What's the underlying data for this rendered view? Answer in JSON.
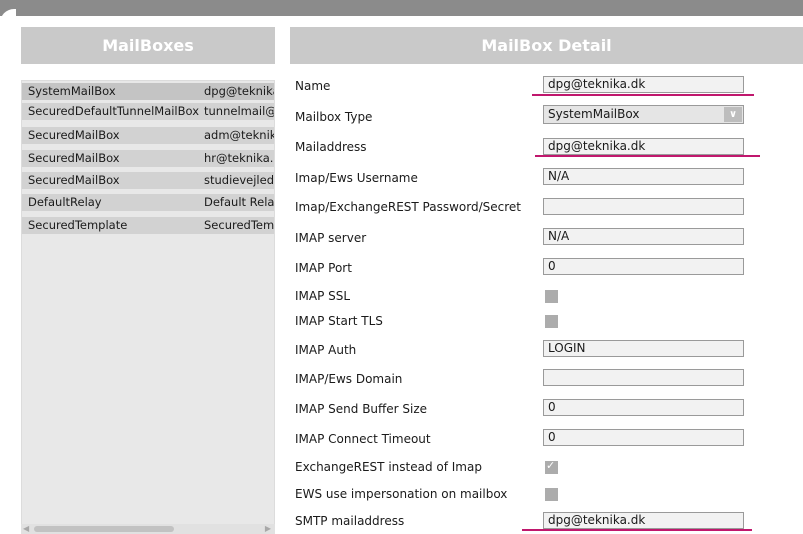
{
  "mailboxes": {
    "title": "MailBoxes",
    "rows": [
      {
        "type": "SystemMailBox",
        "address": "dpg@teknika.dk"
      },
      {
        "type": "SecuredDefaultTunnelMailBox",
        "address": "tunnelmail@teknika.dk"
      },
      {
        "type": "SecuredMailBox",
        "address": "adm@teknika.dk"
      },
      {
        "type": "SecuredMailBox",
        "address": "hr@teknika.dk"
      },
      {
        "type": "SecuredMailBox",
        "address": "studievejleder@teknika.dk"
      },
      {
        "type": "DefaultRelay",
        "address": "Default Relay"
      },
      {
        "type": "SecuredTemplate",
        "address": "SecuredTemplate"
      }
    ]
  },
  "detail": {
    "title": "MailBox Detail",
    "name": {
      "label": "Name",
      "value": "dpg@teknika.dk"
    },
    "mailbox_type": {
      "label": "Mailbox Type",
      "value": "SystemMailBox"
    },
    "mailaddress": {
      "label": "Mailaddress",
      "value": "dpg@teknika.dk"
    },
    "imap_username": {
      "label": "Imap/Ews Username",
      "value": "N/A"
    },
    "imap_password": {
      "label": "Imap/ExchangeREST Password/Secret",
      "value": ""
    },
    "imap_server": {
      "label": "IMAP server",
      "value": "N/A"
    },
    "imap_port": {
      "label": "IMAP Port",
      "value": "0"
    },
    "imap_ssl": {
      "label": "IMAP SSL",
      "checked": false
    },
    "imap_start_tls": {
      "label": "IMAP Start TLS",
      "checked": false
    },
    "imap_auth": {
      "label": "IMAP Auth",
      "value": "LOGIN"
    },
    "imap_domain": {
      "label": "IMAP/Ews Domain",
      "value": ""
    },
    "imap_send_buffer": {
      "label": "IMAP Send Buffer Size",
      "value": "0"
    },
    "imap_connect_timeout": {
      "label": "IMAP Connect Timeout",
      "value": "0"
    },
    "exchange_rest": {
      "label": "ExchangeREST instead of Imap",
      "checked": true
    },
    "ews_impersonation": {
      "label": "EWS use impersonation on mailbox",
      "checked": false
    },
    "smtp_mailaddress": {
      "label": "SMTP mailaddress",
      "value": "dpg@teknika.dk"
    }
  },
  "icons": {
    "dropdown": "chevron-down-icon",
    "check": "checkmark-icon"
  },
  "colors": {
    "accent_underline": "#c0176d",
    "header_bg": "#c9c9c9",
    "header_text": "#ffffff"
  }
}
